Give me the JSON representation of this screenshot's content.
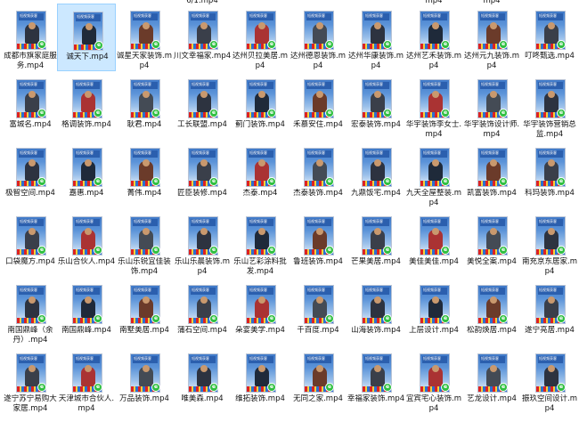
{
  "top_partial_labels": [
    "6/1.mp4",
    "mp4",
    "mp4"
  ],
  "badge_glyph": "e",
  "thumb_banner_text": "短视频获客",
  "colors": {
    "selected_bg": "#cce8ff",
    "badge": "#2fbf40",
    "thumb_sky": "#3f79c8"
  },
  "files": [
    [
      "成都市旗家庭服务.mp4",
      "诚天下.mp4",
      "诚星天家装饰.mp4",
      "川文幸福家.mp4",
      "达州贝拉美居.mp4",
      "达州德恩装饰.mp4",
      "达州华康装饰.mp4",
      "达州艺禾装饰.mp4",
      "达州元九装饰.mp4",
      "叮咚甄选.mp4"
    ],
    [
      "富城名.mp4",
      "格调装饰.mp4",
      "耿君.mp4",
      "工长联盟.mp4",
      "蓟门装饰.mp4",
      "禾慕安住.mp4",
      "宏泰装饰.mp4",
      "华宇装饰李女士.mp4",
      "华宇装饰设计师.mp4",
      "华宇装饰营销总监.mp4"
    ],
    [
      "极智空间.mp4",
      "嘉惠.mp4",
      "菁伟.mp4",
      "匠臣装修.mp4",
      "杰泰.mp4",
      "杰泰装饰.mp4",
      "九鼎饭宅.mp4",
      "九天全屋整装.mp4",
      "凯富装饰.mp4",
      "科玛装饰.mp4"
    ],
    [
      "口袋魔方.mp4",
      "乐山合伙人.mp4",
      "乐山乐锐宜佳装饰.mp4",
      "乐山乐晨装饰.mp4",
      "乐山艺彩涂料批发.mp4",
      "鲁班装饰.mp4",
      "芒果美居.mp4",
      "美佳美佳.mp4",
      "美悦全案.mp4",
      "南充京东居家.mp4"
    ],
    [
      "南国鼎峰（余丹）.mp4",
      "南国鼎峰.mp4",
      "南墅美居.mp4",
      "蒲石空间.mp4",
      "朵宴美学.mp4",
      "千百度.mp4",
      "山海装饰.mp4",
      "上层设计.mp4",
      "松韵焕居.mp4",
      "遂宁亮居.mp4"
    ],
    [
      "遂宁苏宁易购大家居.mp4",
      "天津城市合伙人.mp4",
      "万品装饰.mp4",
      "唯美森.mp4",
      "维拓装饰.mp4",
      "无同之家.mp4",
      "幸福家装饰.mp4",
      "宜宾宅心装饰.mp4",
      "艺龙设计.mp4",
      "振玖空间设计.mp4"
    ]
  ],
  "selected": {
    "row": 0,
    "col": 1
  }
}
